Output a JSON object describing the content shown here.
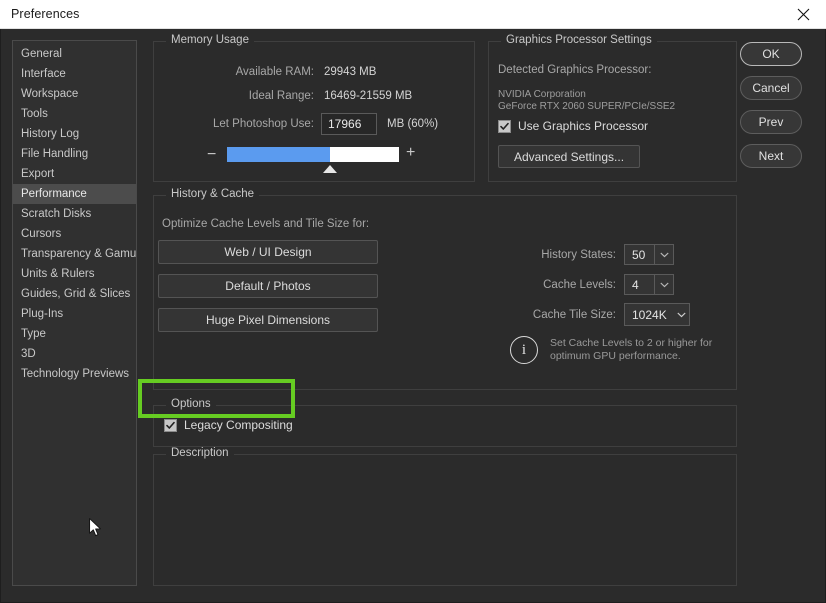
{
  "window": {
    "title": "Preferences",
    "close_icon": "close-icon"
  },
  "sidebar": {
    "items": [
      {
        "label": "General",
        "selected": false
      },
      {
        "label": "Interface",
        "selected": false
      },
      {
        "label": "Workspace",
        "selected": false
      },
      {
        "label": "Tools",
        "selected": false
      },
      {
        "label": "History Log",
        "selected": false
      },
      {
        "label": "File Handling",
        "selected": false
      },
      {
        "label": "Export",
        "selected": false
      },
      {
        "label": "Performance",
        "selected": true
      },
      {
        "label": "Scratch Disks",
        "selected": false
      },
      {
        "label": "Cursors",
        "selected": false
      },
      {
        "label": "Transparency & Gamut",
        "selected": false
      },
      {
        "label": "Units & Rulers",
        "selected": false
      },
      {
        "label": "Guides, Grid & Slices",
        "selected": false
      },
      {
        "label": "Plug-Ins",
        "selected": false
      },
      {
        "label": "Type",
        "selected": false
      },
      {
        "label": "3D",
        "selected": false
      },
      {
        "label": "Technology Previews",
        "selected": false
      }
    ]
  },
  "memory_usage": {
    "legend": "Memory Usage",
    "available_ram_label": "Available RAM:",
    "available_ram_value": "29943 MB",
    "ideal_range_label": "Ideal Range:",
    "ideal_range_value": "16469-21559 MB",
    "let_photoshop_use_label": "Let Photoshop Use:",
    "let_photoshop_use_value": "17966",
    "unit_percent": "MB (60%)",
    "slider_percent": 60,
    "minus_icon": "minus-icon",
    "plus_icon": "plus-icon",
    "fill_color": "#5b9bef",
    "track_color": "#ffffff"
  },
  "graphics": {
    "legend": "Graphics Processor Settings",
    "detected_label": "Detected Graphics Processor:",
    "vendor": "NVIDIA Corporation",
    "model": "GeForce RTX 2060 SUPER/PCIe/SSE2",
    "use_gpu_label": "Use Graphics Processor",
    "use_gpu_checked": true,
    "advanced_button": "Advanced Settings..."
  },
  "history_cache": {
    "legend": "History & Cache",
    "optimize_label": "Optimize Cache Levels and Tile Size for:",
    "buttons": [
      "Web / UI Design",
      "Default / Photos",
      "Huge Pixel Dimensions"
    ],
    "history_states_label": "History States:",
    "history_states_value": "50",
    "cache_levels_label": "Cache Levels:",
    "cache_levels_value": "4",
    "cache_tile_size_label": "Cache Tile Size:",
    "cache_tile_size_value": "1024K",
    "info_icon": "info-icon",
    "info_text_line1": "Set Cache Levels to 2 or higher for",
    "info_text_line2": "optimum GPU performance."
  },
  "options": {
    "legend": "Options",
    "legacy_compositing_label": "Legacy Compositing",
    "legacy_compositing_checked": true,
    "highlight_color": "#66cc22"
  },
  "description": {
    "legend": "Description",
    "text": ""
  },
  "action_buttons": [
    {
      "label": "OK",
      "primary": true
    },
    {
      "label": "Cancel",
      "primary": false
    },
    {
      "label": "Prev",
      "primary": false
    },
    {
      "label": "Next",
      "primary": false
    }
  ]
}
